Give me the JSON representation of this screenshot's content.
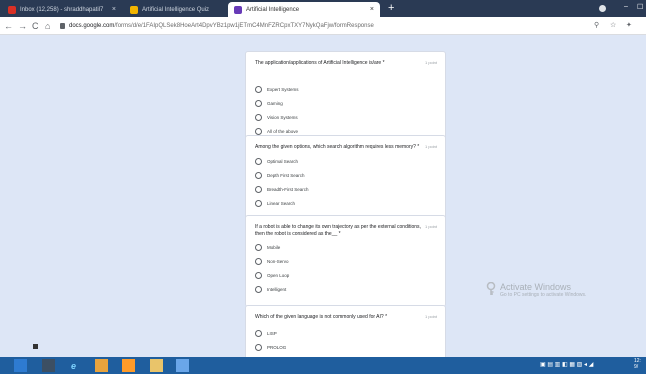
{
  "tabs": [
    {
      "title": "Inbox (12,258) - shraddhapatil7",
      "color": "#d93025"
    },
    {
      "title": "Artificial Intelligence Quiz",
      "color": "#f2b400"
    },
    {
      "title": "Artificial Intelligence",
      "color": "#673ab7"
    }
  ],
  "new_tab": "+",
  "window": {
    "minimize": "–",
    "maximize": "☐"
  },
  "toolbar": {
    "back": "←",
    "forward": "→",
    "reload": "C",
    "home": "⌂"
  },
  "address": {
    "host": "docs.google.com",
    "path": "/forms/d/e/1FAIpQLSek8HoeArt4DpvYBz1pw1jETmC4MnFZRCpxTXY7NykQaFjw/formResponse"
  },
  "toolbar_icons": {
    "search": "⚲",
    "star": "☆",
    "ext": "✦"
  },
  "questions": [
    {
      "text": "The application/applications of Artificial Intelligence is/are *",
      "points": "1 point",
      "options": [
        "Expert Systems",
        "Gaming",
        "Vision Systems",
        "All of the above"
      ]
    },
    {
      "text": "Among the given options, which search algorithm requires less memory? *",
      "points": "1 point",
      "options": [
        "Optimal Search",
        "Depth First Search",
        "Breadth-First Search",
        "Linear Search"
      ]
    },
    {
      "text": "If a robot is able to change its own trajectory as per the external conditions, then the robot is considered as the__ *",
      "points": "1 point",
      "options": [
        "Mobile",
        "Non-Servo",
        "Open Loop",
        "Intelligent"
      ]
    },
    {
      "text": "Which of the given language is not commonly used for AI? *",
      "points": "1 point",
      "options": [
        "LISP",
        "PROLOG"
      ]
    }
  ],
  "watermark": {
    "title": "Activate Windows",
    "sub": "Go to PC settings to activate Windows."
  },
  "taskbar": {
    "app_e": "e"
  },
  "clock": {
    "time": "12:",
    "date": "9/"
  }
}
